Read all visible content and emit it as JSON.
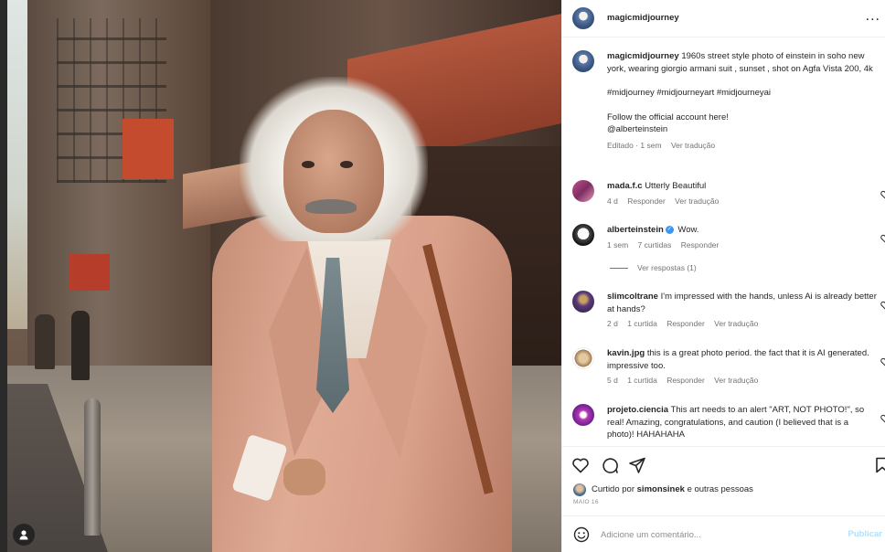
{
  "post": {
    "author": "magicmidjourney",
    "caption": "1960s street style photo of einstein in soho new york, wearing giorgio armani suit , sunset , shot on Agfa Vista 200, 4k",
    "hashtags": "#midjourney #midjourneyart #midjourneyai",
    "follow_line": "Follow the official account here!",
    "mention": "@alberteinstein",
    "edited": "Editado",
    "time": "1 sem",
    "translate": "Ver tradução",
    "more": "..."
  },
  "comments": [
    {
      "user": "mada.f.c",
      "text": "Utterly Beautiful",
      "time": "4 d",
      "reply": "Responder",
      "translate": "Ver tradução"
    },
    {
      "user": "alberteinstein",
      "verified": true,
      "text": "Wow.",
      "time": "1 sem",
      "likes": "7 curtidas",
      "reply": "Responder",
      "view_replies": "Ver respostas (1)"
    },
    {
      "user": "slimcoltrane",
      "text": "I'm impressed with the hands, unless Ai is already better at hands?",
      "time": "2 d",
      "likes": "1 curtida",
      "reply": "Responder",
      "translate": "Ver tradução"
    },
    {
      "user": "kavin.jpg",
      "text": "this is a great photo period. the fact that it is AI generated. impressive too.",
      "time": "5 d",
      "likes": "1 curtida",
      "reply": "Responder",
      "translate": "Ver tradução"
    },
    {
      "user": "projeto.ciencia",
      "text": "This art needs to an alert \"ART, NOT PHOTO!\", so real! Amazing, congratulations, and caution (I believed that is a photo)! HAHAHAHA"
    }
  ],
  "likes": {
    "prefix": "Curtido por",
    "user": "simonsinek",
    "suffix": "e outras pessoas"
  },
  "date": "MAIO 16",
  "add_comment": {
    "placeholder": "Adicione um comentário...",
    "publish": "Publicar"
  },
  "icons": {
    "like": "heart-icon",
    "comment": "comment-icon",
    "share": "paper-plane-icon",
    "save": "bookmark-icon",
    "emoji": "smiley-icon",
    "user_tag": "user-icon"
  }
}
